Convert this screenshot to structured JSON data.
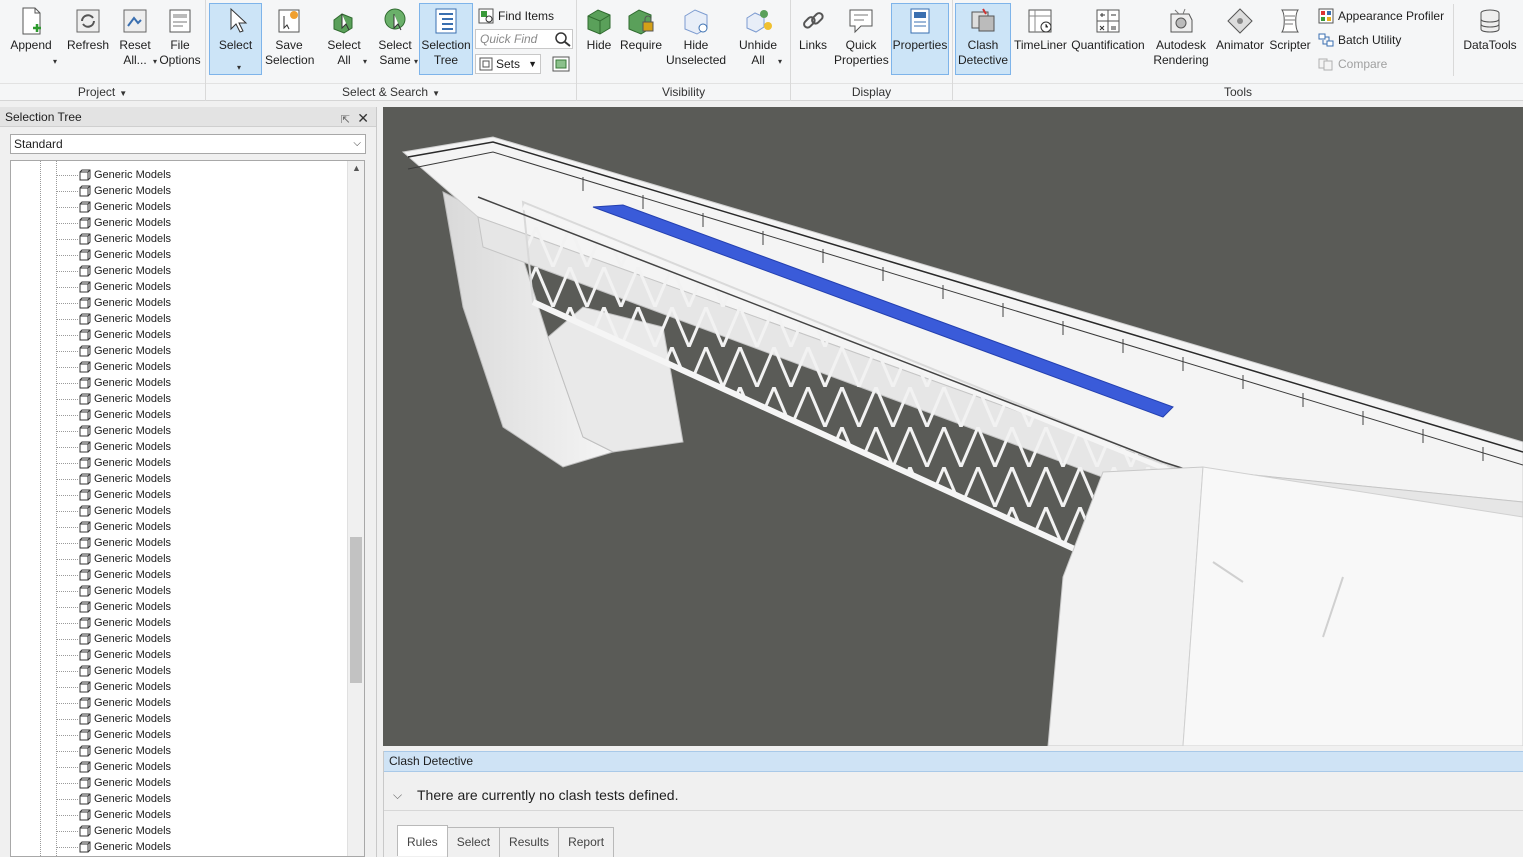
{
  "ribbon": {
    "project": {
      "label": "Project",
      "buttons": {
        "append": "Append",
        "refresh": "Refresh",
        "reset_all": "Reset\nAll...",
        "file_options": "File\nOptions"
      }
    },
    "select_search": {
      "label": "Select & Search",
      "buttons": {
        "select": "Select",
        "save_selection": "Save\nSelection",
        "select_all": "Select\nAll",
        "select_same": "Select\nSame",
        "selection_tree": "Selection\nTree"
      },
      "find_items": "Find Items",
      "quick_find_placeholder": "Quick Find",
      "sets": "Sets"
    },
    "visibility": {
      "label": "Visibility",
      "buttons": {
        "hide": "Hide",
        "require": "Require",
        "hide_unselected": "Hide\nUnselected",
        "unhide_all": "Unhide\nAll"
      }
    },
    "display": {
      "label": "Display",
      "buttons": {
        "links": "Links",
        "quick_properties": "Quick\nProperties",
        "properties": "Properties"
      }
    },
    "tools": {
      "label": "Tools",
      "buttons": {
        "clash_detective": "Clash\nDetective",
        "timeliner": "TimeLiner",
        "quantification": "Quantification",
        "autodesk_rendering": "Autodesk\nRendering",
        "animator": "Animator",
        "scripter": "Scripter",
        "datatools": "DataTools"
      },
      "appearance_profiler": "Appearance Profiler",
      "batch_utility": "Batch Utility",
      "compare": "Compare"
    }
  },
  "selection_tree": {
    "title": "Selection Tree",
    "mode": "Standard",
    "items": [
      "Generic Models",
      "Generic Models",
      "Generic Models",
      "Generic Models",
      "Generic Models",
      "Generic Models",
      "Generic Models",
      "Generic Models",
      "Generic Models",
      "Generic Models",
      "Generic Models",
      "Generic Models",
      "Generic Models",
      "Generic Models",
      "Generic Models",
      "Generic Models",
      "Generic Models",
      "Generic Models",
      "Generic Models",
      "Generic Models",
      "Generic Models",
      "Generic Models",
      "Generic Models",
      "Generic Models",
      "Generic Models",
      "Generic Models",
      "Generic Models",
      "Generic Models",
      "Generic Models",
      "Generic Models",
      "Generic Models",
      "Generic Models",
      "Generic Models",
      "Generic Models",
      "Generic Models",
      "Generic Models",
      "Generic Models",
      "Generic Models",
      "Generic Models",
      "Generic Models",
      "Generic Models",
      "Generic Models",
      "Generic Models",
      "Generic Models"
    ]
  },
  "clash_detective": {
    "title": "Clash Detective",
    "message": "There are currently no clash tests defined.",
    "tabs": [
      "Rules",
      "Select",
      "Results",
      "Report"
    ]
  },
  "colors": {
    "accent": "#cce4f7",
    "viewport_bg": "#5a5b57",
    "highlight": "#3a5bd9"
  }
}
